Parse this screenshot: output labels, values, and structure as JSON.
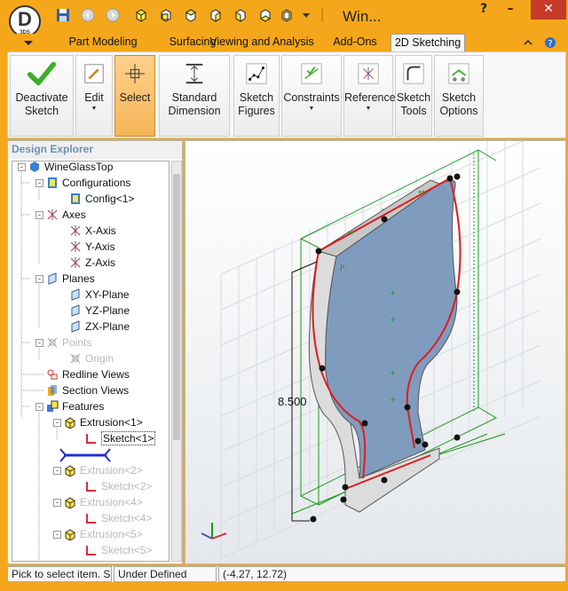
{
  "window": {
    "title": "Win...",
    "app_logo": "D",
    "app_logo_sub": "3DS"
  },
  "ribbon_tabs": [
    {
      "label": "Part Modeling"
    },
    {
      "label": "Surfacing"
    },
    {
      "label": "Viewing and Analysis"
    },
    {
      "label": "Add-Ons"
    },
    {
      "label": "2D Sketching",
      "active": true
    }
  ],
  "ribbon": {
    "deactivate": "Deactivate Sketch",
    "edit": "Edit",
    "select": "Select",
    "standard_dimension": "Standard Dimension",
    "sketch_figures": "Sketch Figures",
    "constraints": "Constraints",
    "reference": "Reference",
    "sketch_tools": "Sketch Tools",
    "sketch_options": "Sketch Options"
  },
  "explorer": {
    "title": "Design Explorer",
    "items": [
      {
        "label": "WineGlassTop"
      },
      {
        "label": "Configurations"
      },
      {
        "label": "Config<1>"
      },
      {
        "label": "Axes"
      },
      {
        "label": "X-Axis"
      },
      {
        "label": "Y-Axis"
      },
      {
        "label": "Z-Axis"
      },
      {
        "label": "Planes"
      },
      {
        "label": "XY-Plane"
      },
      {
        "label": "YZ-Plane"
      },
      {
        "label": "ZX-Plane"
      },
      {
        "label": "Points"
      },
      {
        "label": "Origin"
      },
      {
        "label": "Redline Views"
      },
      {
        "label": "Section Views"
      },
      {
        "label": "Features"
      },
      {
        "label": "Extrusion<1>"
      },
      {
        "label": "Sketch<1>"
      },
      {
        "label": "Extrusion<2>"
      },
      {
        "label": "Sketch<2>"
      },
      {
        "label": "Extrusion<4>"
      },
      {
        "label": "Sketch<4>"
      },
      {
        "label": "Extrusion<5>"
      },
      {
        "label": "Sketch<5>"
      }
    ]
  },
  "viewport": {
    "dimension_label": "8.500"
  },
  "status": {
    "hint": "Pick to select item. Sh",
    "state": "Under Defined",
    "coords": "(-4.27, 12.72)"
  },
  "colors": {
    "accent": "#f4a71a",
    "profile": "#e01c1c",
    "construction": "#1a9a1a",
    "body": "#7f9cbf"
  }
}
